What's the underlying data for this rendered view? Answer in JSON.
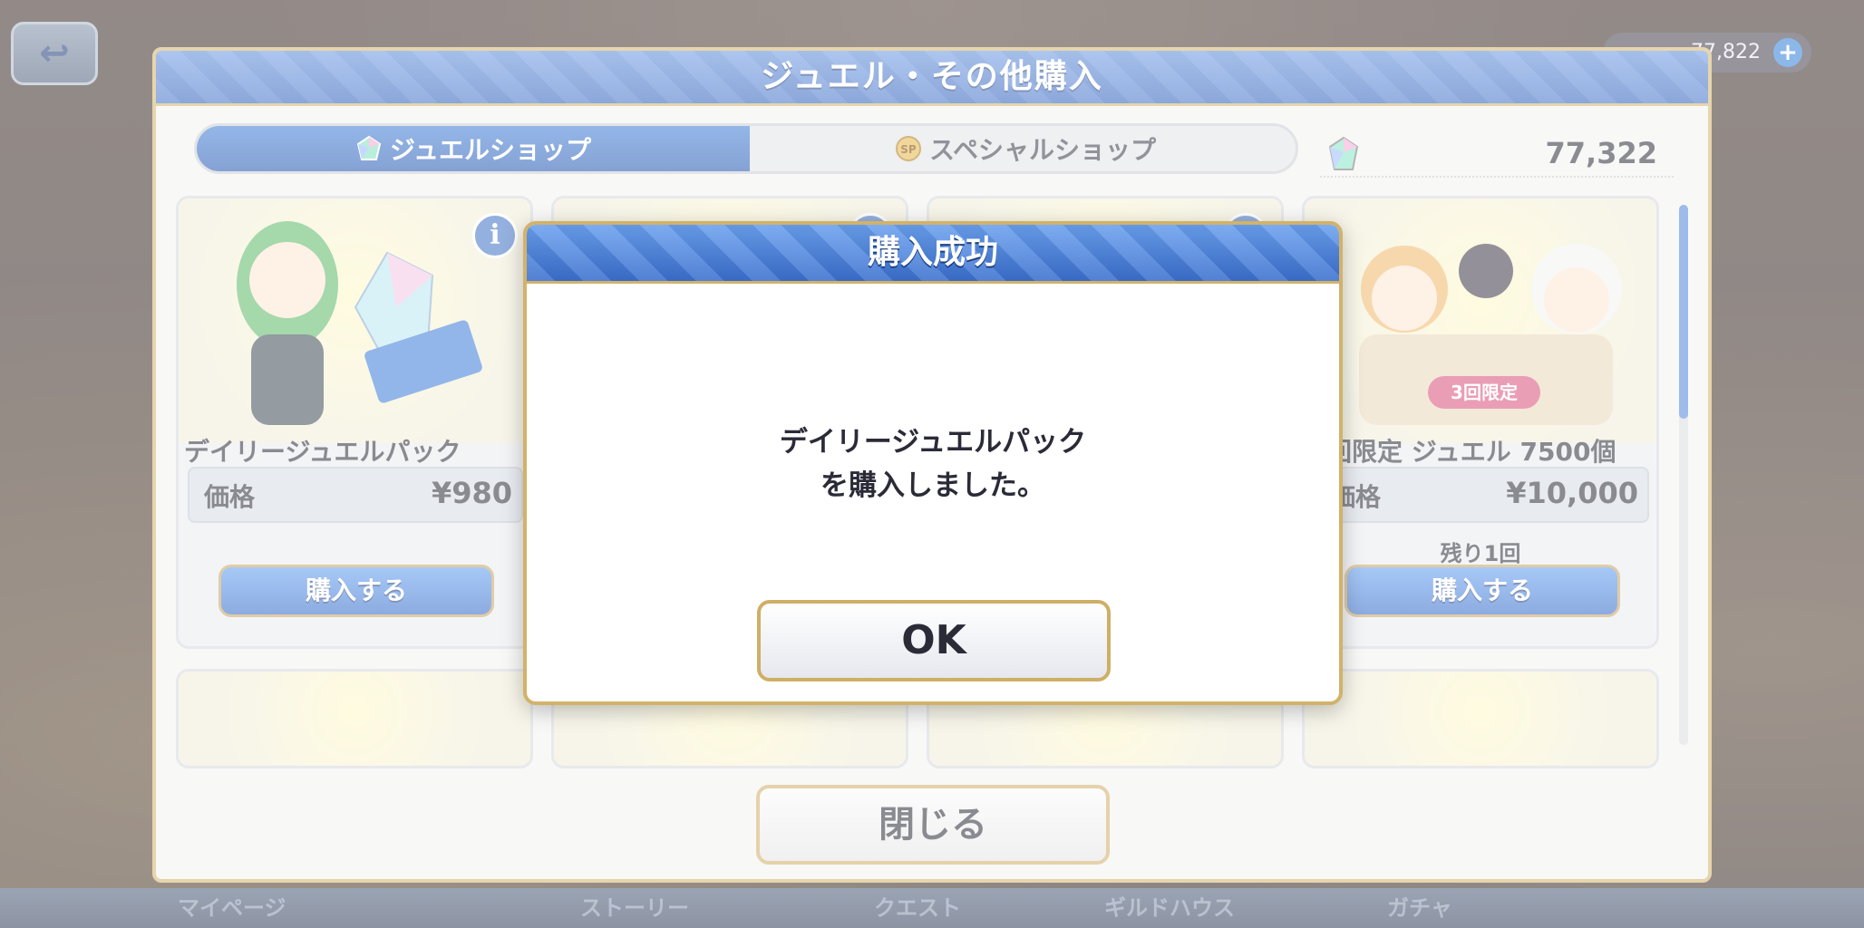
{
  "header": {
    "top_gem_count": "77,822",
    "plus_label": "+"
  },
  "bottom_nav": {
    "items": [
      "マイページ",
      "ストーリー",
      "クエスト",
      "ギルドハウス",
      "ガチャ"
    ]
  },
  "window": {
    "title": "ジュエル・その他購入",
    "tabs": [
      {
        "label": "ジュエルショップ",
        "selected": true
      },
      {
        "label": "スペシャルショップ",
        "selected": false
      }
    ],
    "gem_count": "77,322",
    "close_label": "閉じる"
  },
  "products": [
    {
      "name": "デイリージュエルパック",
      "price_label": "価格",
      "price": "¥980",
      "buy_label": "購入する"
    },
    {
      "name": "回限定 ジュエル 7500個",
      "price_label": "価格",
      "price": "¥10,000",
      "remaining": "残り1回",
      "badge": "3回限定",
      "buy_label": "購入する"
    }
  ],
  "modal": {
    "title": "購入成功",
    "message_line1": "デイリージュエルパック",
    "message_line2": "を購入しました。",
    "ok_label": "OK"
  },
  "colors": {
    "accent_blue": "#2f63c2",
    "gold_border": "#d2b26a",
    "badge_pink": "#d84f79"
  }
}
